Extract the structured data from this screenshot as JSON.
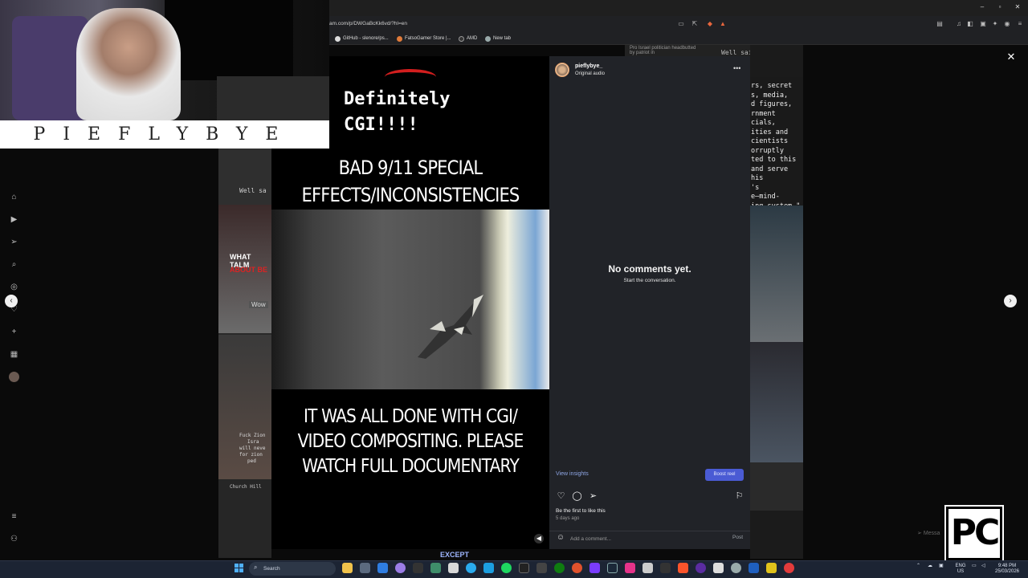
{
  "browser": {
    "address": "am.com/p/DWGaBcKk6vd/?hl=en",
    "bookmarks": [
      {
        "label": "GitHub - slenore/ps..."
      },
      {
        "label": "FatsoGamer Store |..."
      },
      {
        "label": "AMD"
      },
      {
        "label": "New tab"
      }
    ]
  },
  "background": {
    "top_strip_text": "Pro Israel politician headbutted by patriot in",
    "top_strip_text2": "Well said all",
    "left_tile_texts": [
      "Well sa",
      "WHAT TALM",
      "ABOUT BE",
      "Wow",
      "Fuck Zion",
      "Isra",
      "will neve",
      "for zion",
      "ped",
      "Church Hill"
    ],
    "right_tile_texts": [
      "rs, secret",
      "s, media,",
      "d figures,",
      "rnment",
      "cials,",
      "ities and",
      "cientists",
      "orruptly",
      "ted to this",
      "and serve",
      "his",
      "'s",
      "e—mind-",
      "ing system.\""
    ],
    "bottom_text": "EXCEPT"
  },
  "webcam": {
    "label": "PIEFLYBYE"
  },
  "video": {
    "caption": "Definitely CGI!!!!",
    "heading": "BAD 9/11 SPECIAL EFFECTS/INCONSISTENCIES",
    "footer": "IT WAS ALL DONE WITH CGI/ VIDEO COMPOSITING. PLEASE WATCH FULL DOCUMENTARY"
  },
  "post": {
    "username": "pieflybye_",
    "audio": "Original audio",
    "no_comments_title": "No comments yet.",
    "no_comments_subtitle": "Start the conversation.",
    "view_insights": "View insights",
    "boost_label": "Boost reel",
    "likes_text": "Be the first to like this",
    "timestamp": "5 days ago",
    "comment_placeholder": "Add a comment...",
    "post_label": "Post"
  },
  "messages_label": "Messa",
  "pc_logo": "PC",
  "taskbar": {
    "search_label": "Search",
    "lang_top": "ENG",
    "lang_bottom": "US",
    "time": "9:48 PM",
    "date": "25/03/2026"
  },
  "colors": {
    "accent_boost": "#4a5bd4",
    "link_blue": "#8fa7e6",
    "panel_bg": "#212328",
    "video_caption_red": "#d21e1e"
  },
  "icons": {
    "sidebar": [
      "home-icon",
      "reels-icon",
      "send-icon",
      "search-icon",
      "explore-icon",
      "heart-icon",
      "create-icon",
      "dashboard-icon",
      "profile-icon",
      "menu-icon",
      "meta-icon"
    ]
  }
}
